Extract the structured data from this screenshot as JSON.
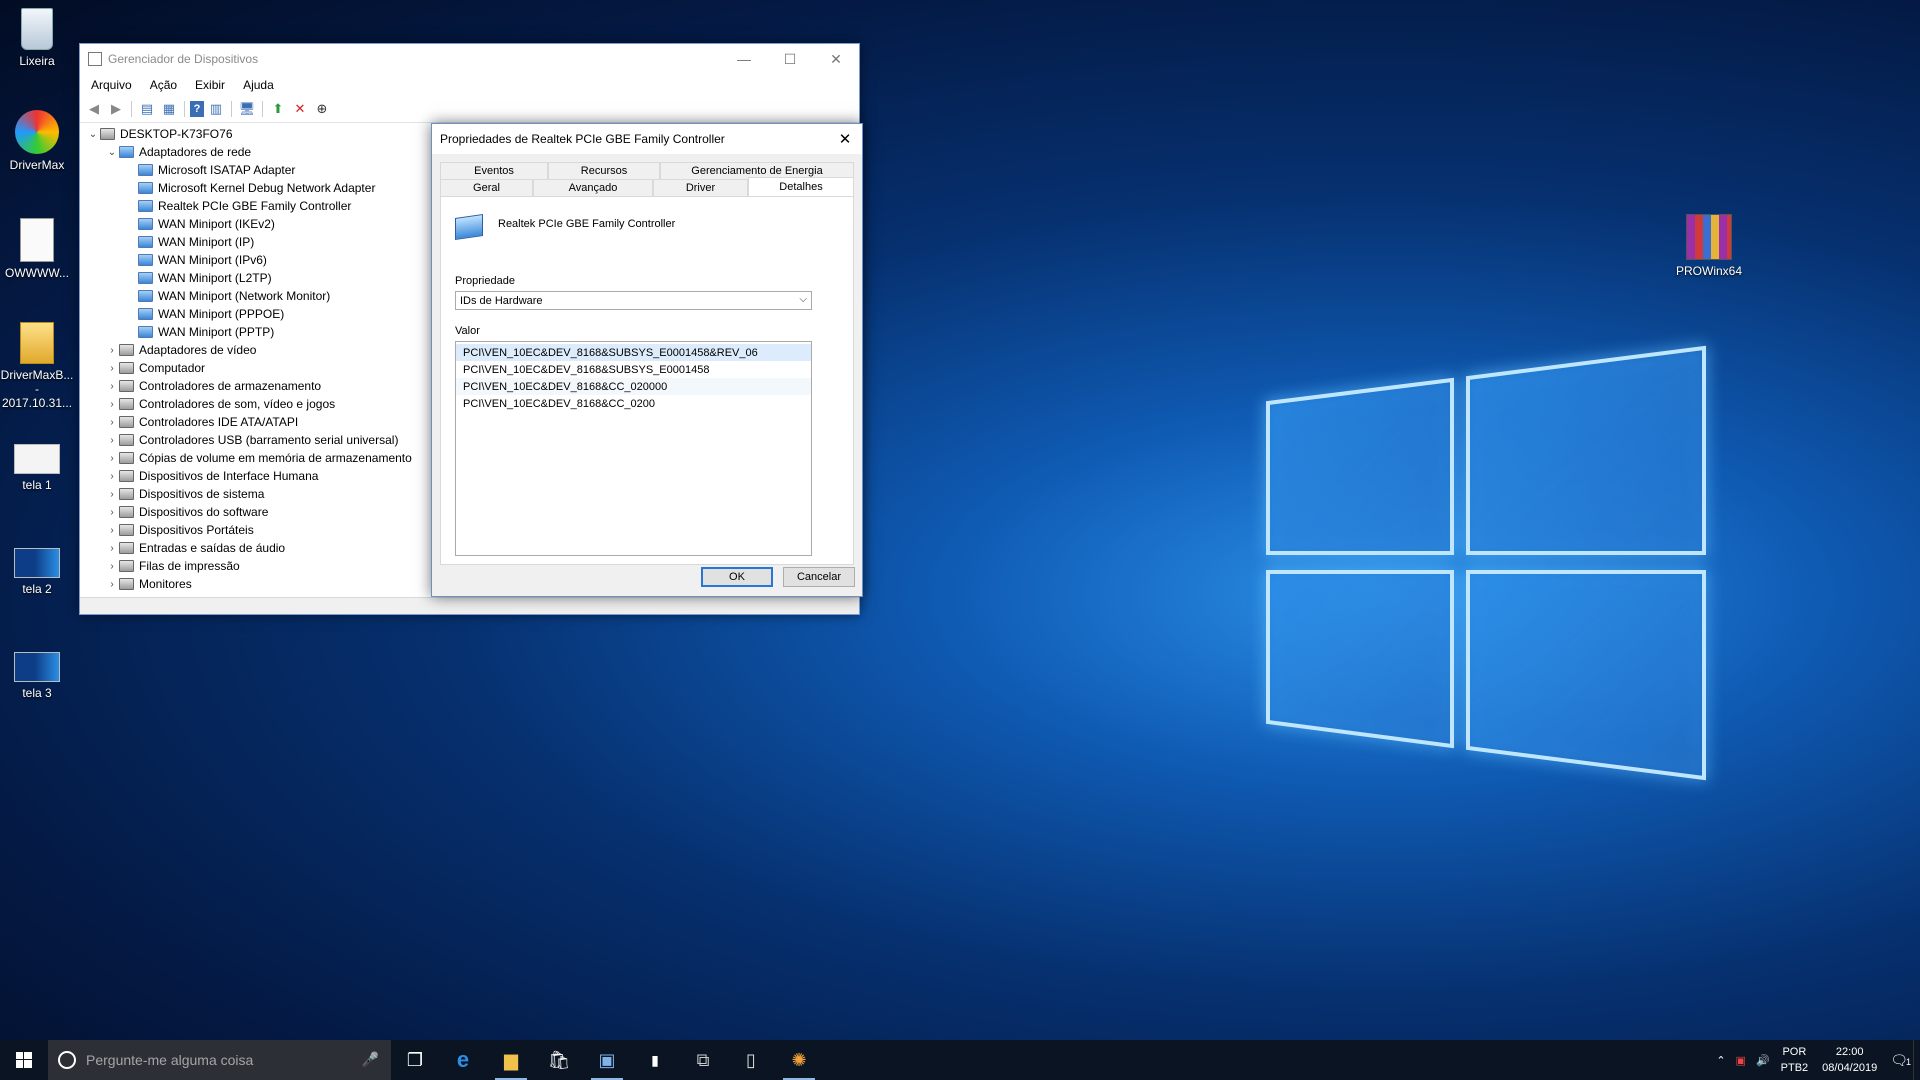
{
  "desktop": {
    "icons": [
      {
        "label": "Lixeira",
        "icon": "recycle-bin-icon"
      },
      {
        "label": "DriverMax",
        "icon": "drivermax-icon"
      },
      {
        "label": "OWWWW...",
        "icon": "document-icon"
      },
      {
        "label": "DriverMaxB... - 2017.10.31...",
        "icon": "folder-icon"
      },
      {
        "label": "tela 1",
        "icon": "image-icon"
      },
      {
        "label": "tela 2",
        "icon": "image-icon"
      },
      {
        "label": "tela 3",
        "icon": "image-icon"
      },
      {
        "label": "PROWinx64",
        "icon": "winrar-archive-icon"
      }
    ]
  },
  "device_manager": {
    "title": "Gerenciador de Dispositivos",
    "menu": [
      "Arquivo",
      "Ação",
      "Exibir",
      "Ajuda"
    ],
    "tree": {
      "root": "DESKTOP-K73FO76",
      "expanded_category": "Adaptadores de rede",
      "adapters": [
        "Microsoft ISATAP Adapter",
        "Microsoft Kernel Debug Network Adapter",
        "Realtek PCIe GBE Family Controller",
        "WAN Miniport (IKEv2)",
        "WAN Miniport (IP)",
        "WAN Miniport (IPv6)",
        "WAN Miniport (L2TP)",
        "WAN Miniport (Network Monitor)",
        "WAN Miniport (PPPOE)",
        "WAN Miniport (PPTP)"
      ],
      "categories": [
        "Adaptadores de vídeo",
        "Computador",
        "Controladores de armazenamento",
        "Controladores de som, vídeo e jogos",
        "Controladores IDE ATA/ATAPI",
        "Controladores USB (barramento serial universal)",
        "Cópias de volume em memória de armazenamento",
        "Dispositivos de Interface Humana",
        "Dispositivos de sistema",
        "Dispositivos do software",
        "Dispositivos Portáteis",
        "Entradas e saídas de áudio",
        "Filas de impressão",
        "Monitores"
      ]
    }
  },
  "properties_dialog": {
    "title": "Propriedades de Realtek PCIe GBE Family Controller",
    "tabs_top": [
      "Eventos",
      "Recursos",
      "Gerenciamento de Energia"
    ],
    "tabs_bottom": [
      "Geral",
      "Avançado",
      "Driver",
      "Detalhes"
    ],
    "active_tab": "Detalhes",
    "device_name": "Realtek PCIe GBE Family Controller",
    "property_label": "Propriedade",
    "property_value": "IDs de Hardware",
    "value_label": "Valor",
    "values": [
      "PCI\\VEN_10EC&DEV_8168&SUBSYS_E0001458&REV_06",
      "PCI\\VEN_10EC&DEV_8168&SUBSYS_E0001458",
      "PCI\\VEN_10EC&DEV_8168&CC_020000",
      "PCI\\VEN_10EC&DEV_8168&CC_0200"
    ],
    "ok_label": "OK",
    "cancel_label": "Cancelar"
  },
  "taskbar": {
    "search_placeholder": "Pergunte-me alguma coisa",
    "language": "POR",
    "keyboard": "PTB2",
    "time": "22:00",
    "date": "08/04/2019",
    "notification_count": "1"
  }
}
